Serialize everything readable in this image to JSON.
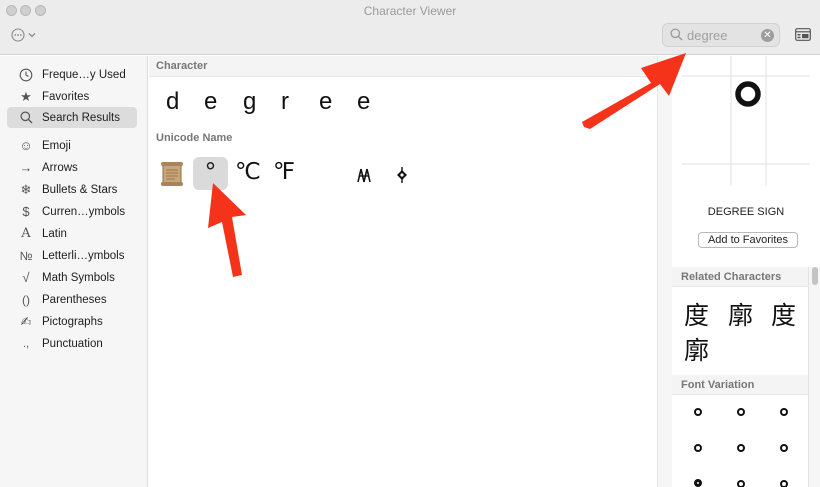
{
  "window": {
    "title": "Character Viewer"
  },
  "toolbar": {
    "action_icon": "ellipsis-circle-icon",
    "search": {
      "value": "degree",
      "placeholder": "Search"
    }
  },
  "sidebar": {
    "items": [
      {
        "label": "Freque…y Used",
        "icon": "clock-icon"
      },
      {
        "label": "Favorites",
        "icon": "star-icon"
      },
      {
        "label": "Search Results",
        "icon": "search-icon",
        "selected": true
      },
      {
        "label": "Emoji",
        "icon": "smiley-icon"
      },
      {
        "label": "Arrows",
        "icon": "arrow-icon"
      },
      {
        "label": "Bullets & Stars",
        "icon": "asterisk-icon"
      },
      {
        "label": "Curren…ymbols",
        "icon": "dollar-icon"
      },
      {
        "label": "Latin",
        "icon": "latin-a-icon"
      },
      {
        "label": "Letterli…ymbols",
        "icon": "numero-icon"
      },
      {
        "label": "Math Symbols",
        "icon": "sqrt-icon"
      },
      {
        "label": "Parentheses",
        "icon": "parentheses-icon"
      },
      {
        "label": "Pictographs",
        "icon": "pen-icon"
      },
      {
        "label": "Punctuation",
        "icon": "punctuation-icon"
      }
    ]
  },
  "main": {
    "character_header": "Character",
    "character_results": [
      "d",
      "e",
      "g",
      "r",
      "e",
      "e"
    ],
    "unicode_header": "Unicode Name",
    "unicode_results": [
      {
        "glyph": "scroll",
        "icon": "scroll-icon"
      },
      {
        "glyph": "°",
        "selected": true
      },
      {
        "glyph": "℃"
      },
      {
        "glyph": "℉"
      },
      {
        "glyph": "᪴",
        "icon": "symbol-a-icon"
      },
      {
        "glyph": "⸙",
        "icon": "symbol-b-icon"
      }
    ]
  },
  "inspector": {
    "preview_glyph": "°",
    "character_name": "DEGREE SIGN",
    "add_favorites_label": "Add to Favorites",
    "related_header": "Related Characters",
    "related_characters": [
      "度",
      "廓",
      "度",
      "廓"
    ],
    "font_variation_header": "Font Variation",
    "font_variations": [
      "°",
      "°",
      "°",
      "°",
      "°",
      "°",
      "°",
      "°",
      "°"
    ]
  },
  "annotations": {
    "arrow_color": "#f5321a"
  }
}
